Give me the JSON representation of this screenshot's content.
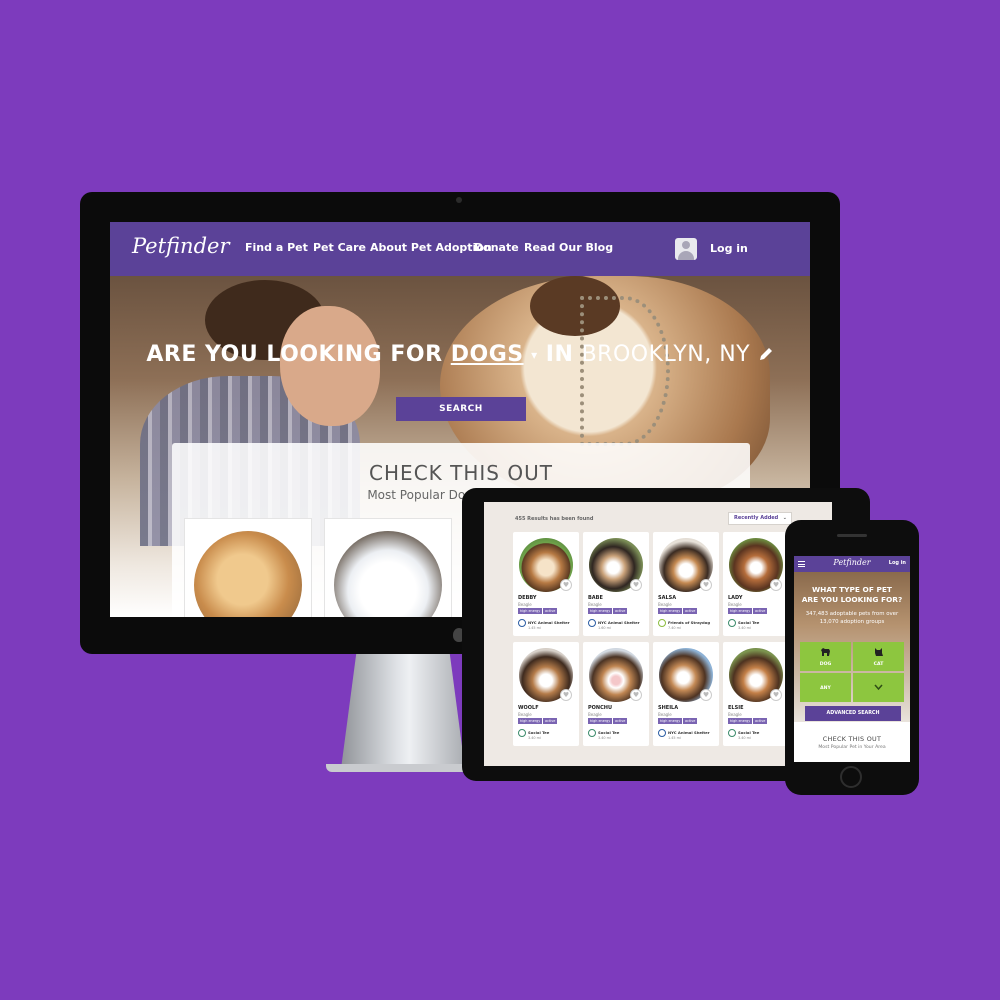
{
  "desktop": {
    "logo": "Petfinder",
    "nav": [
      "Find a Pet",
      "Pet Care",
      "About Pet Adoption",
      "Donate",
      "Read Our Blog"
    ],
    "login": "Log in",
    "headline": {
      "prefix": "ARE YOU LOOKING FOR ",
      "pet": "DOGS",
      "caret": "▾",
      "middle": " IN ",
      "location": "BROOKLYN, NY"
    },
    "search_label": "SEARCH",
    "panel_title": "CHECK THIS OUT",
    "panel_subtitle": "Most Popular Dogs in Your Area"
  },
  "tablet": {
    "results": "455 Results has been found",
    "sort": "Recently Added",
    "sort_caret": "⌄",
    "tag1": "high energy",
    "tag2": "active",
    "cards": [
      {
        "name": "DEBBY",
        "breed": "Beagle",
        "shelter": "NYC Animal Shelter",
        "distance": "1.45 mi"
      },
      {
        "name": "BABE",
        "breed": "Beagle",
        "shelter": "NYC Animal Shelter",
        "distance": "1.60 mi"
      },
      {
        "name": "SALSA",
        "breed": "Beagle",
        "shelter": "Friends of Straydog",
        "distance": "7.40 mi"
      },
      {
        "name": "LADY",
        "breed": "Beagle",
        "shelter": "Social Tee",
        "distance": "3.40 mi"
      },
      {
        "name": "WOOLF",
        "breed": "Beagle",
        "shelter": "Social Tee",
        "distance": "3.40 mi"
      },
      {
        "name": "PONCHU",
        "breed": "Beagle",
        "shelter": "Social Tee",
        "distance": "3.40 mi"
      },
      {
        "name": "SHEILA",
        "breed": "Beagle",
        "shelter": "NYC Animal Shelter",
        "distance": "1.45 mi"
      },
      {
        "name": "ELSIE",
        "breed": "Beagle",
        "shelter": "Social Tee",
        "distance": "3.40 mi"
      }
    ]
  },
  "phone": {
    "logo": "Petfinder",
    "login": "Log in",
    "question_line1": "WHAT TYPE OF PET",
    "question_line2": "ARE YOU LOOKING FOR?",
    "stats_line1": "347,483 adoptable pets from over",
    "stats_line2": "13,070 adoption groups",
    "tiles": [
      "DOG",
      "CAT",
      "ANY",
      ""
    ],
    "advanced_search": "ADVANCED SEARCH",
    "check_title": "CHECK THIS OUT",
    "check_subtitle": "Most Popular Pet in Your Area"
  },
  "colors": {
    "background": "#7d3bbd",
    "brand_purple": "#5b4298",
    "tile_green": "#8dc63f"
  }
}
